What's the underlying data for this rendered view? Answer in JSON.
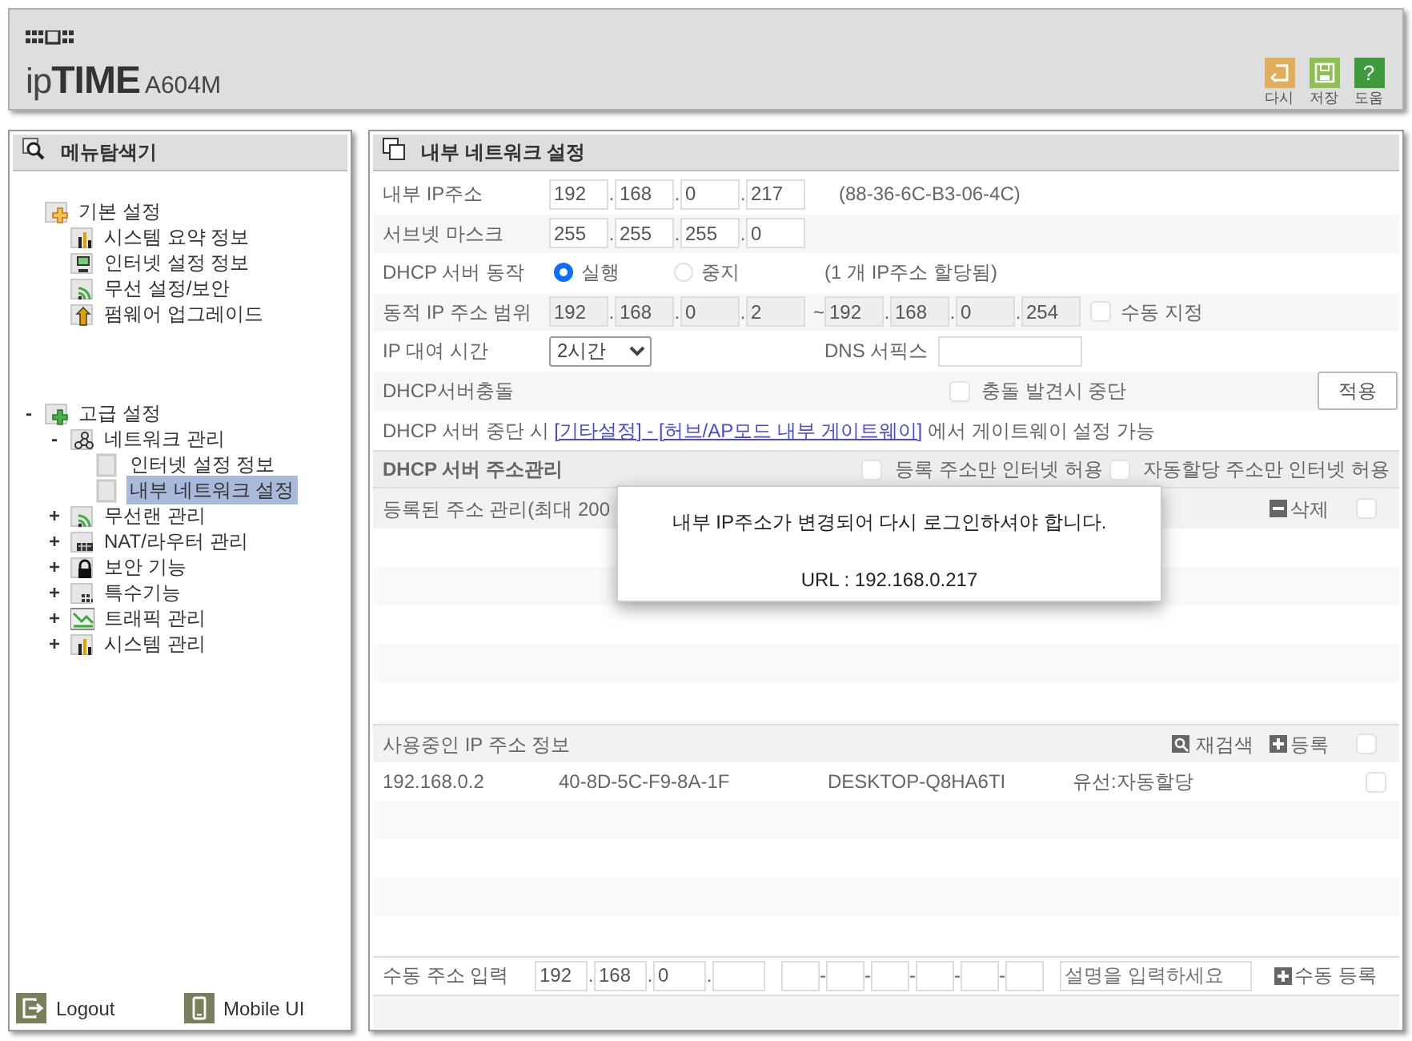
{
  "header": {
    "brand": "ip**TIME**",
    "model": "A604M",
    "toolbar": [
      {
        "label": "다시",
        "kind": "undo",
        "color": "#e0ad5a"
      },
      {
        "label": "저장",
        "kind": "save",
        "color": "#8dc050"
      },
      {
        "label": "도움",
        "kind": "help",
        "glyph": "?",
        "color": "#3d9a3d"
      }
    ]
  },
  "sidebar": {
    "title": "메뉴탐색기",
    "tree": [
      {
        "label": "기본 설정",
        "kind": "folder-orange",
        "selected": false,
        "children": [
          {
            "label": "시스템 요약 정보",
            "kind": "chart",
            "selected": false
          },
          {
            "label": "인터넷 설정 정보",
            "kind": "monitor",
            "selected": false
          },
          {
            "label": "무선 설정/보안",
            "kind": "wifi",
            "selected": false
          },
          {
            "label": "펌웨어 업그레이드",
            "kind": "upload",
            "selected": false
          }
        ]
      },
      {
        "label": "고급 설정",
        "kind": "folder-green",
        "toggle": "-",
        "selected": false,
        "children": [
          {
            "label": "네트워크 관리",
            "kind": "network",
            "toggle": "-",
            "selected": false,
            "children": [
              {
                "label": "인터넷 설정 정보",
                "kind": "page",
                "selected": false
              },
              {
                "label": "내부 네트워크 설정",
                "kind": "page",
                "selected": true
              }
            ]
          },
          {
            "label": "무선랜 관리",
            "kind": "wifi",
            "toggle": "+",
            "selected": false
          },
          {
            "label": "NAT/라우터 관리",
            "kind": "router",
            "toggle": "+",
            "selected": false
          },
          {
            "label": "보안 기능",
            "kind": "lock",
            "toggle": "+",
            "selected": false
          },
          {
            "label": "특수기능",
            "kind": "grid",
            "toggle": "+",
            "selected": false
          },
          {
            "label": "트래픽 관리",
            "kind": "traffic",
            "toggle": "+",
            "selected": false
          },
          {
            "label": "시스템 관리",
            "kind": "chart",
            "toggle": "+",
            "selected": false
          }
        ]
      }
    ],
    "footer": [
      {
        "label": "Logout",
        "kind": "logout"
      },
      {
        "label": "Mobile UI",
        "kind": "mobile"
      }
    ]
  },
  "main": {
    "title": "내부 네트워크 설정",
    "ip_address": {
      "label": "내부 IP주소",
      "separator": ".",
      "fields": [
        {
          "value": "192"
        },
        {
          "value": "168"
        },
        {
          "value": "0"
        },
        {
          "value": "217"
        }
      ],
      "note": "(88-36-6C-B3-06-4C)"
    },
    "subnet_mask": {
      "label": "서브넷 마스크",
      "separator": ".",
      "fields": [
        {
          "value": "255"
        },
        {
          "value": "255"
        },
        {
          "value": "255"
        },
        {
          "value": "0"
        }
      ]
    },
    "dhcp_server": {
      "label": "DHCP 서버 동작",
      "options": [
        {
          "label": "실행",
          "selected": true
        },
        {
          "label": "중지",
          "selected": false
        }
      ],
      "note": "(1 개 IP주소 할당됨)"
    },
    "dynamic_range": {
      "label": "동적 IP 주소 범위",
      "separator": ".",
      "disabled": true,
      "start": [
        {
          "value": "192"
        },
        {
          "value": "168"
        },
        {
          "value": "0"
        },
        {
          "value": "2"
        }
      ],
      "range_mark": "~",
      "end": [
        {
          "value": "192"
        },
        {
          "value": "168"
        },
        {
          "value": "0"
        },
        {
          "value": "254"
        }
      ],
      "manual": {
        "label": "수동 지정",
        "checked": false
      }
    },
    "lease_time": {
      "label": "IP 대여 시간",
      "value": "2시간",
      "dns_label": "DNS 서픽스"
    },
    "conflict": {
      "label": "DHCP서버충돌",
      "checkbox": {
        "label": "충돌 발견시 중단",
        "checked": false
      },
      "apply": "적용"
    },
    "gateway_note": {
      "before": "DHCP 서버 중단 시 ",
      "link": "[기타설정] - [허브/AP모드 내부 게이트웨이]",
      "after": " 에서 게이트웨이 설정 가능"
    },
    "address_management": {
      "title": "DHCP 서버 주소관리",
      "options": [
        {
          "label": "등록 주소만 인터넷 허용",
          "checked": false
        },
        {
          "label": "자동할당 주소만 인터넷 허용",
          "checked": false
        }
      ]
    },
    "registered": {
      "title": "등록된 주소 관리(최대 200",
      "delete": "삭제",
      "select_all": false
    },
    "in_use": {
      "title": "사용중인 IP 주소 정보",
      "rescan": "재검색",
      "register": "등록",
      "select_all": false,
      "rows": [
        {
          "cells": [
            "192.168.0.2",
            "40-8D-5C-F9-8A-1F",
            "DESKTOP-Q8HA6TI",
            "유선:자동할당"
          ],
          "checked": false
        }
      ]
    },
    "manual_entry": {
      "label": "수동 주소 입력",
      "separator": ".",
      "ip": [
        {
          "value": "192"
        },
        {
          "value": "168"
        },
        {
          "value": "0"
        },
        {
          "kind": "blank"
        }
      ],
      "mac_separator": "-",
      "mac": [
        {
          "kind": "blank"
        },
        {
          "kind": "blank"
        },
        {
          "kind": "blank"
        },
        {
          "kind": "blank"
        },
        {
          "kind": "blank"
        },
        {
          "kind": "blank"
        }
      ],
      "description_placeholder": "설명을 입력하세요",
      "register": "수동 등록"
    },
    "popup": {
      "message": "내부 IP주소가 변경되어 다시 로그인하셔야 합니다.",
      "url": "URL : 192.168.0.217"
    }
  }
}
